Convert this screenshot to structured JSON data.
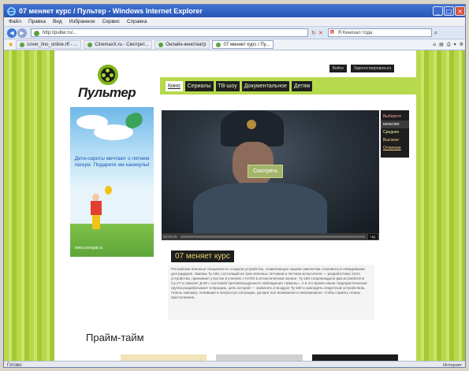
{
  "window": {
    "title": "07 меняет курс / Пультер - Windows Internet Explorer"
  },
  "menu": [
    "Файл",
    "Правка",
    "Вид",
    "Избранное",
    "Сервис",
    "Справка"
  ],
  "address": {
    "url": "http://pulter.ru/..."
  },
  "search": {
    "placeholder": "Я Кинозал тода"
  },
  "tabs": [
    {
      "label": "cover_lino_online.rtf - ..."
    },
    {
      "label": "CinemaxX.ru - Смотрет..."
    },
    {
      "label": "Онлайн-кинотеатр"
    },
    {
      "label": "07 меняет курс / Пу..."
    }
  ],
  "site": {
    "logo_text": "Пультер",
    "top_links": [
      "Войти",
      "Зарегистрироваться"
    ],
    "nav": [
      {
        "label": "Кино",
        "active": true
      },
      {
        "label": "Сериалы",
        "active": false
      },
      {
        "label": "ТВ-шоу",
        "active": false
      },
      {
        "label": "Документальное",
        "active": false
      },
      {
        "label": "Детям",
        "active": false
      }
    ],
    "promo": {
      "text": "Дети-сироты мечтают о летнем лагере. Подарите им каникулы!",
      "url": "www.coexpat.ru"
    },
    "player": {
      "watch_label": "Смотреть",
      "time": "00:00:00",
      "hd": "НД",
      "quality_header": "Выберите",
      "quality_options": [
        {
          "label": "качество",
          "selected": true
        },
        {
          "label": "Среднее",
          "selected": false
        },
        {
          "label": "Высокое",
          "selected": false
        },
        {
          "label": "Отличное",
          "selected": false
        }
      ]
    },
    "episode": {
      "title": "07 меняет курс",
      "description": "Российские военные специалисты создали устройство, позволяющее нашим самолетам становиться невидимыми для радаров. Экипаж Ту-160, состоящий из трех военных летчиков и летчика-испытателя — разработчика этого устройства, принимает участие в учениях с НАТО в атлантическом океане. Ту-160 сопровождали два истребителя Су-27 и самолет Д-50 с системой противовоздушного наблюдения «Шмель». А в это время некая террористическая группа разрабатывает операцию, цель которой — захватить в воздухе Ту-160 и завладеть секретным устройством. Члены экипажа, попавшие в непростую ситуацию, делают все возможное и невозможное, чтобы сорвать планы преступников..."
    },
    "section_title": "Прайм-тайм"
  },
  "status": {
    "left": "Готово",
    "right": "Интернет"
  },
  "colors": {
    "accent_green": "#b6d94d",
    "nav_dark": "#1f1f1f",
    "title_gold": "#e8cf6a"
  }
}
